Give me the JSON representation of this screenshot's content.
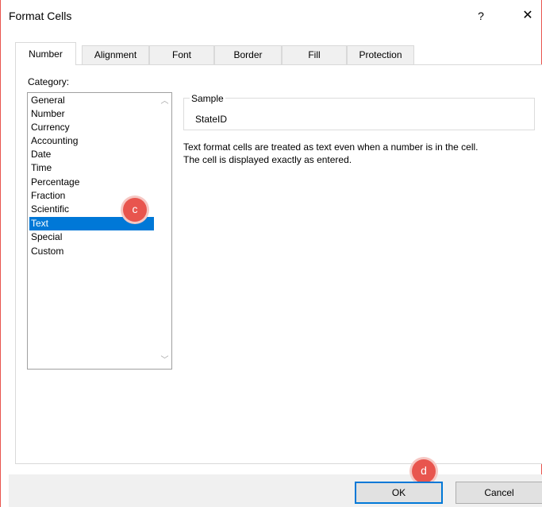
{
  "window": {
    "title": "Format Cells",
    "help_label": "?",
    "close_label": "✕"
  },
  "tabs": [
    {
      "label": "Number",
      "active": true
    },
    {
      "label": "Alignment"
    },
    {
      "label": "Font"
    },
    {
      "label": "Border"
    },
    {
      "label": "Fill"
    },
    {
      "label": "Protection"
    }
  ],
  "category": {
    "label": "Category:",
    "items": [
      "General",
      "Number",
      "Currency",
      "Accounting",
      "Date",
      "Time",
      "Percentage",
      "Fraction",
      "Scientific",
      "Text",
      "Special",
      "Custom"
    ],
    "selected": "Text"
  },
  "sample": {
    "legend": "Sample",
    "value": "StateID"
  },
  "description": {
    "line1": "Text format cells are treated as text even when a number is in the cell.",
    "line2": "The cell is displayed exactly as entered."
  },
  "markers": {
    "c": "c",
    "d": "d"
  },
  "buttons": {
    "ok": "OK",
    "cancel": "Cancel"
  },
  "icons": {
    "scroll_up": "chevron-up-icon",
    "scroll_down": "chevron-down-icon"
  },
  "colors": {
    "selection": "#0078d7",
    "marker": "#e8554e"
  }
}
